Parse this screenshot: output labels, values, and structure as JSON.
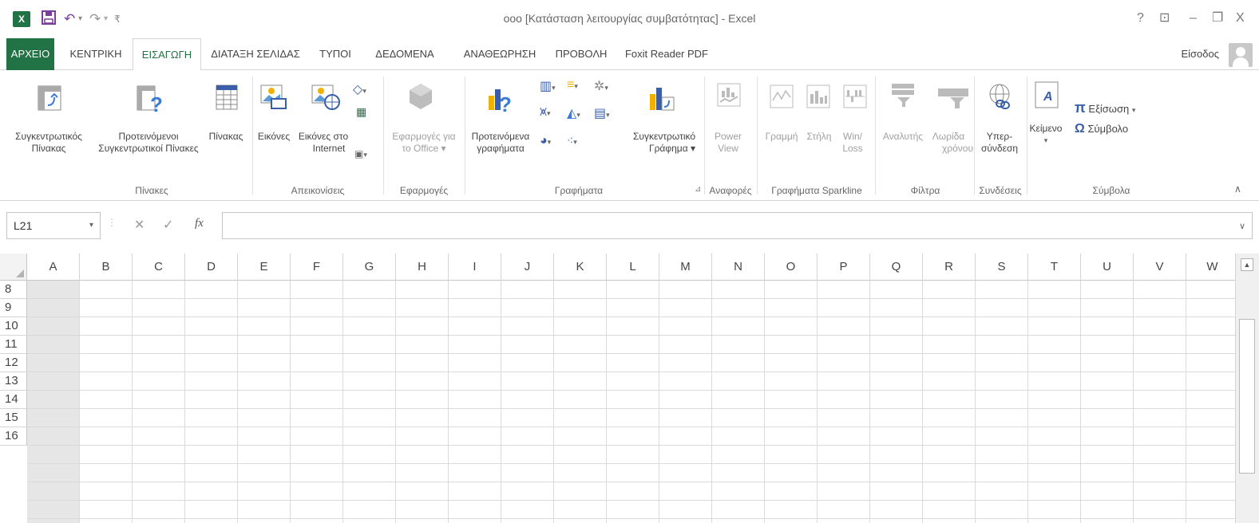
{
  "titlebar": {
    "app_logo": "X",
    "title": "οοο  [Κατάσταση λειτουργίας συμβατότητας] - Excel",
    "help": "?",
    "ribbon_options": "⊡",
    "minimize": "–",
    "restore": "❐",
    "close": "X"
  },
  "tabs": [
    "ΑΡΧΕΙΟ",
    "ΚΕΝΤΡΙΚΗ",
    "ΕΙΣΑΓΩΓΗ",
    "ΔΙΑΤΑΞΗ ΣΕΛΙΔΑΣ",
    "ΤΥΠΟΙ",
    "ΔΕΔΟΜΕΝΑ",
    "ΑΝΑΘΕΩΡΗΣΗ",
    "ΠΡΟΒΟΛΗ",
    "Foxit Reader PDF"
  ],
  "active_tab": "ΕΙΣΑΓΩΓΗ",
  "signin": "Είσοδος",
  "ribbon": {
    "pivot_table": [
      "Συγκεντρωτικός",
      "Πίνακας"
    ],
    "recommended_pivot": [
      "Προτεινόμενοι",
      "Συγκεντρωτικοί Πίνακες"
    ],
    "table": "Πίνακας",
    "group_tables": "Πίνακες",
    "pictures": "Εικόνες",
    "online_pictures": [
      "Εικόνες στο",
      "Internet"
    ],
    "group_illustrations": "Απεικονίσεις",
    "apps_for_office": [
      "Εφαρμογές για",
      "το Office"
    ],
    "group_apps": "Εφαρμογές",
    "recommended_charts": [
      "Προτεινόμενα",
      "γραφήματα"
    ],
    "pivot_chart": [
      "Συγκεντρωτικό",
      "Γράφημα"
    ],
    "group_charts": "Γραφήματα",
    "power_view": [
      "Power",
      "View"
    ],
    "group_reports": "Αναφορές",
    "spark_line": "Γραμμή",
    "spark_column": "Στήλη",
    "spark_winloss": [
      "Win/",
      "Loss"
    ],
    "group_sparklines": "Γραφήματα Sparkline",
    "slicer": "Αναλυτής",
    "timeline": [
      "Λωρίδα",
      "χρόνου"
    ],
    "group_filters": "Φίλτρα",
    "hyperlink": [
      "Υπερ-",
      "σύνδεση"
    ],
    "group_links": "Συνδέσεις",
    "text": "Κείμενο",
    "equation": "Εξίσωση",
    "symbol": "Σύμβολο",
    "group_symbols": "Σύμβολα"
  },
  "formula_bar": {
    "name_box": "L21",
    "cancel": "✕",
    "enter": "✓",
    "fx": "fx",
    "value": ""
  },
  "grid": {
    "columns": [
      "A",
      "B",
      "C",
      "D",
      "E",
      "F",
      "G",
      "H",
      "I",
      "J",
      "K",
      "L",
      "M",
      "N",
      "O",
      "P",
      "Q",
      "R",
      "S",
      "T",
      "U",
      "V",
      "W"
    ],
    "rows": [
      "8",
      "9",
      "10",
      "11",
      "12",
      "13",
      "14",
      "15",
      "16"
    ]
  },
  "colors": {
    "excel_green": "#217346",
    "title_icon_purple": "#7a3f9c"
  }
}
